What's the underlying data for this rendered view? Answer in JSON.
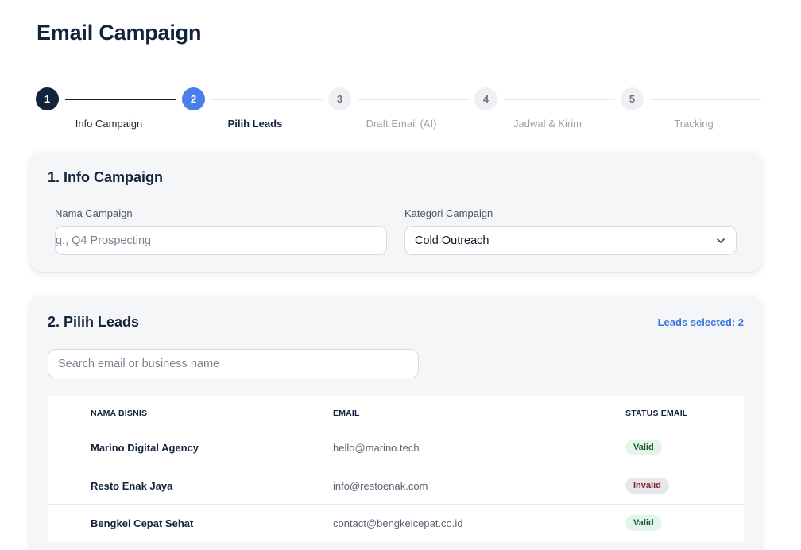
{
  "page": {
    "title": "Email Campaign"
  },
  "stepper": {
    "steps": [
      {
        "number": "1",
        "label": "Info Campaign",
        "state": "completed"
      },
      {
        "number": "2",
        "label": "Pilih Leads",
        "state": "active"
      },
      {
        "number": "3",
        "label": "Draft Email (AI)",
        "state": "pending"
      },
      {
        "number": "4",
        "label": "Jadwal & Kirim",
        "state": "pending"
      },
      {
        "number": "5",
        "label": "Tracking",
        "state": "pending"
      }
    ]
  },
  "info_campaign": {
    "title": "1. Info Campaign",
    "name_label": "Nama Campaign",
    "name_placeholder": "g., Q4 Prospecting",
    "category_label": "Kategori Campaign",
    "category_value": "Cold Outreach"
  },
  "pilih_leads": {
    "title": "2. Pilih Leads",
    "selected_text": "Leads selected: 2",
    "search_placeholder": "Search email or business name",
    "columns": {
      "name": "NAMA BISNIS",
      "email": "EMAIL",
      "status": "STATUS EMAIL"
    },
    "rows": [
      {
        "name": "Marino Digital Agency",
        "email": "hello@marino.tech",
        "status": "Valid"
      },
      {
        "name": "Resto Enak Jaya",
        "email": "info@restoenak.com",
        "status": "Invalid"
      },
      {
        "name": "Bengkel Cepat Sehat",
        "email": "contact@bengkelcepat.co.id",
        "status": "Valid"
      }
    ]
  },
  "colors": {
    "primary": "#14233c",
    "accent": "#4b7fe8",
    "valid_bg": "#e2f5e8",
    "invalid_bg": "#e6e7ea"
  },
  "icons": {
    "select": "chevron-down-icon"
  }
}
